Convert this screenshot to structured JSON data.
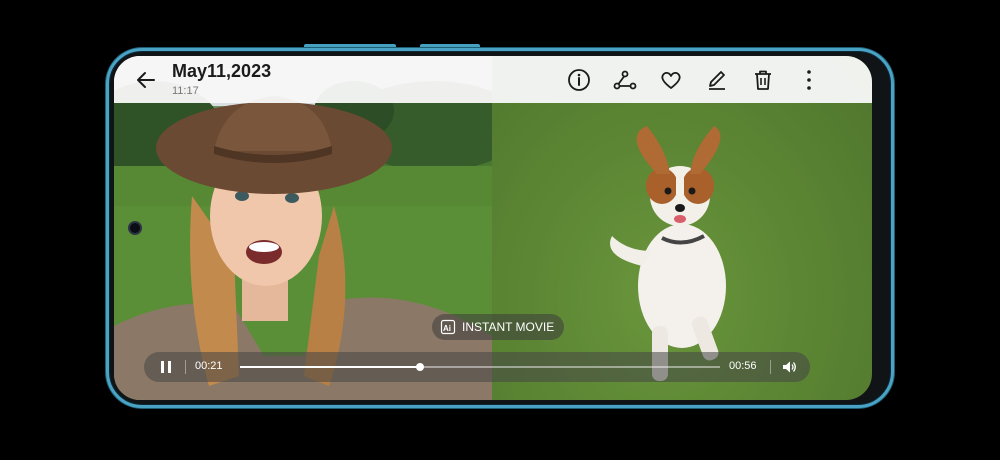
{
  "header": {
    "date": "May11,2023",
    "time": "11:17"
  },
  "toolbar": {
    "icons": [
      "info-icon",
      "share-icon",
      "favorite-icon",
      "edit-icon",
      "delete-icon",
      "more-icon"
    ]
  },
  "overlay": {
    "instant_movie_label": "INSTANT MOVIE"
  },
  "player": {
    "current_time": "00:21",
    "total_time": "00:56",
    "progress": 0.375,
    "state": "playing"
  },
  "colors": {
    "frame_accent": "#4aa3c4",
    "toolbar_bg": "#f7f7f7",
    "toolbar_icon": "#1b1b1b"
  }
}
